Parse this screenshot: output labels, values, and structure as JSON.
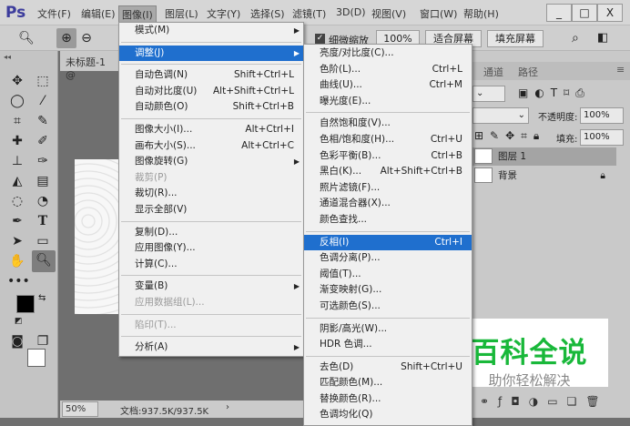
{
  "app": {
    "logo": "Ps"
  },
  "menubar": [
    "文件(F)",
    "编辑(E)",
    "图像(I)",
    "图层(L)",
    "文字(Y)",
    "选择(S)",
    "滤镜(T)",
    "3D(D)",
    "视图(V)",
    "窗口(W)",
    "帮助(H)"
  ],
  "window_controls": [
    "_",
    "□",
    "X"
  ],
  "options": {
    "scrubby_zoom_label": "细微缩放",
    "scrubby_zoom_checked": true,
    "zoom_value": "100%",
    "fit_screen": "适合屏幕",
    "fill_screen": "填充屏幕"
  },
  "document": {
    "tab_title": "未标题-1 @",
    "zoom": "50%",
    "doc_size": "文档:937.5K/937.5K"
  },
  "image_menu": [
    {
      "label": "模式(M)",
      "sub": true
    },
    {
      "sep": true
    },
    {
      "label": "调整(J)",
      "sub": true,
      "highlight": true
    },
    {
      "sep": true
    },
    {
      "label": "自动色调(N)",
      "shortcut": "Shift+Ctrl+L"
    },
    {
      "label": "自动对比度(U)",
      "shortcut": "Alt+Shift+Ctrl+L"
    },
    {
      "label": "自动颜色(O)",
      "shortcut": "Shift+Ctrl+B"
    },
    {
      "sep": true
    },
    {
      "label": "图像大小(I)...",
      "shortcut": "Alt+Ctrl+I"
    },
    {
      "label": "画布大小(S)...",
      "shortcut": "Alt+Ctrl+C"
    },
    {
      "label": "图像旋转(G)",
      "sub": true
    },
    {
      "label": "裁剪(P)",
      "disabled": true
    },
    {
      "label": "裁切(R)..."
    },
    {
      "label": "显示全部(V)"
    },
    {
      "sep": true
    },
    {
      "label": "复制(D)..."
    },
    {
      "label": "应用图像(Y)..."
    },
    {
      "label": "计算(C)..."
    },
    {
      "sep": true
    },
    {
      "label": "变量(B)",
      "sub": true
    },
    {
      "label": "应用数据组(L)...",
      "disabled": true
    },
    {
      "sep": true
    },
    {
      "label": "陷印(T)...",
      "disabled": true
    },
    {
      "sep": true
    },
    {
      "label": "分析(A)",
      "sub": true
    }
  ],
  "adjust_menu": [
    {
      "label": "亮度/对比度(C)..."
    },
    {
      "label": "色阶(L)...",
      "shortcut": "Ctrl+L"
    },
    {
      "label": "曲线(U)...",
      "shortcut": "Ctrl+M"
    },
    {
      "label": "曝光度(E)..."
    },
    {
      "sep": true
    },
    {
      "label": "自然饱和度(V)..."
    },
    {
      "label": "色相/饱和度(H)...",
      "shortcut": "Ctrl+U"
    },
    {
      "label": "色彩平衡(B)...",
      "shortcut": "Ctrl+B"
    },
    {
      "label": "黑白(K)...",
      "shortcut": "Alt+Shift+Ctrl+B"
    },
    {
      "label": "照片滤镜(F)..."
    },
    {
      "label": "通道混合器(X)..."
    },
    {
      "label": "颜色查找..."
    },
    {
      "sep": true
    },
    {
      "label": "反相(I)",
      "shortcut": "Ctrl+I",
      "highlight": true
    },
    {
      "label": "色调分离(P)..."
    },
    {
      "label": "阈值(T)..."
    },
    {
      "label": "渐变映射(G)..."
    },
    {
      "label": "可选颜色(S)..."
    },
    {
      "sep": true
    },
    {
      "label": "阴影/高光(W)..."
    },
    {
      "label": "HDR 色调..."
    },
    {
      "sep": true
    },
    {
      "label": "去色(D)",
      "shortcut": "Shift+Ctrl+U"
    },
    {
      "label": "匹配颜色(M)..."
    },
    {
      "label": "替换颜色(R)..."
    },
    {
      "label": "色调均化(Q)"
    }
  ],
  "panel": {
    "tabs": [
      "通道",
      "路径"
    ],
    "opacity_label": "不透明度:",
    "opacity": "100%",
    "fill_label": "填充:",
    "fill": "100%",
    "layers": [
      {
        "name": "图层 1",
        "selected": true
      },
      {
        "name": "背景",
        "locked": true
      }
    ]
  },
  "watermark": {
    "title": "百科全说",
    "subtitle": "助你轻松解决"
  },
  "colors": {
    "accent": "#1f6fce",
    "watermark_green": "#19b83a"
  }
}
